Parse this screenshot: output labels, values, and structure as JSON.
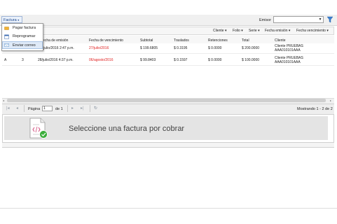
{
  "toolbar": {
    "factura_label": "Factura",
    "emisor_label": "Emisor",
    "emisor_value": ""
  },
  "menu": {
    "items": [
      {
        "label": "Pagar factura",
        "icon": "pay-icon"
      },
      {
        "label": "Reprogramar",
        "icon": "calendar-icon"
      },
      {
        "label": "Enviar correo",
        "icon": "mail-icon"
      }
    ]
  },
  "filters": [
    "Cliente",
    "Folio",
    "Serie",
    "Fecha emisión",
    "Fecha vencimiento"
  ],
  "grid": {
    "headers": [
      "Fecha de emisión",
      "Fecha de vencimiento",
      "Subtotal",
      "Traslados",
      "Retenciones",
      "Total",
      "Cliente"
    ],
    "rows": [
      {
        "c0": "",
        "c1": "",
        "emision": "ó/julio/2016 2:47 p.m.",
        "vencimiento": "27/julio/2016",
        "subtotal": "$ 199.6805",
        "traslados": "$ 0.3195",
        "retenciones": "$ 0.0000",
        "total": "$ 200.0000",
        "cliente1": "Cliente PRUEBAS",
        "cliente2": "AAA010101AAA"
      },
      {
        "c0": "A",
        "c1": "3",
        "emision": "28/julio/2016 4:37 p.m.",
        "vencimiento": "06/agosto/2016",
        "subtotal": "$ 99.8403",
        "traslados": "$ 0.1597",
        "retenciones": "$ 0.0000",
        "total": "$ 100.0000",
        "cliente1": "Cliente PRUEBAS",
        "cliente2": "AAA010101AAA"
      }
    ]
  },
  "pager": {
    "page_label": "Página",
    "page_value": "1",
    "of_label": "de 1",
    "summary": "Mostrando 1 - 2 de 2"
  },
  "detail": {
    "message": "Seleccione una factura por cobrar"
  },
  "colors": {
    "accent": "#15428b",
    "due_red": "#e02020",
    "menu_active": "#dfeaf8"
  }
}
